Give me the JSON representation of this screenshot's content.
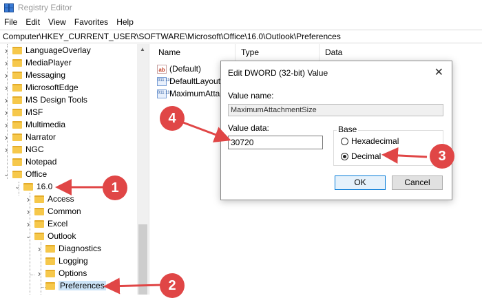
{
  "window": {
    "title": "Registry Editor"
  },
  "menu": [
    "File",
    "Edit",
    "View",
    "Favorites",
    "Help"
  ],
  "address": "Computer\\HKEY_CURRENT_USER\\SOFTWARE\\Microsoft\\Office\\16.0\\Outlook\\Preferences",
  "tree": [
    {
      "label": "LanguageOverlay",
      "chevron": ">"
    },
    {
      "label": "MediaPlayer",
      "chevron": ">"
    },
    {
      "label": "Messaging",
      "chevron": ">"
    },
    {
      "label": "MicrosoftEdge",
      "chevron": ">"
    },
    {
      "label": "MS Design Tools",
      "chevron": ">"
    },
    {
      "label": "MSF",
      "chevron": ">"
    },
    {
      "label": "Multimedia",
      "chevron": ">"
    },
    {
      "label": "Narrator",
      "chevron": ">"
    },
    {
      "label": "NGC",
      "chevron": ">"
    },
    {
      "label": "Notepad",
      "chevron": ""
    },
    {
      "label": "Office",
      "chevron": "v"
    },
    {
      "label": "16.0",
      "chevron": "v"
    },
    {
      "label": "Access",
      "chevron": ">"
    },
    {
      "label": "Common",
      "chevron": ">"
    },
    {
      "label": "Excel",
      "chevron": ">"
    },
    {
      "label": "Outlook",
      "chevron": "v"
    },
    {
      "label": "Diagnostics",
      "chevron": ">"
    },
    {
      "label": "Logging",
      "chevron": ""
    },
    {
      "label": "Options",
      "chevron": ">"
    },
    {
      "label": "Preferences",
      "chevron": ""
    }
  ],
  "list": {
    "headers": [
      "Name",
      "Type",
      "Data"
    ],
    "rows": [
      {
        "icon": "string-value-icon",
        "icon_text": "ab",
        "name": "(Default)"
      },
      {
        "icon": "dword-value-icon",
        "icon_text": "011 110",
        "name": "DefaultLayoutA"
      },
      {
        "icon": "dword-value-icon",
        "icon_text": "011 110",
        "name": "MaximumAtta"
      }
    ]
  },
  "dialog": {
    "title": "Edit DWORD (32-bit) Value",
    "close_glyph": "✕",
    "value_name_label": "Value name:",
    "value_name": "MaximumAttachmentSize",
    "value_data_label": "Value data:",
    "value_data": "30720",
    "base_label": "Base",
    "hex_label": "Hexadecimal",
    "dec_label": "Decimal",
    "selected_base": "Decimal",
    "ok_label": "OK",
    "cancel_label": "Cancel"
  },
  "annotations": {
    "color": "#e04646",
    "badges": [
      "1",
      "2",
      "3",
      "4"
    ]
  }
}
